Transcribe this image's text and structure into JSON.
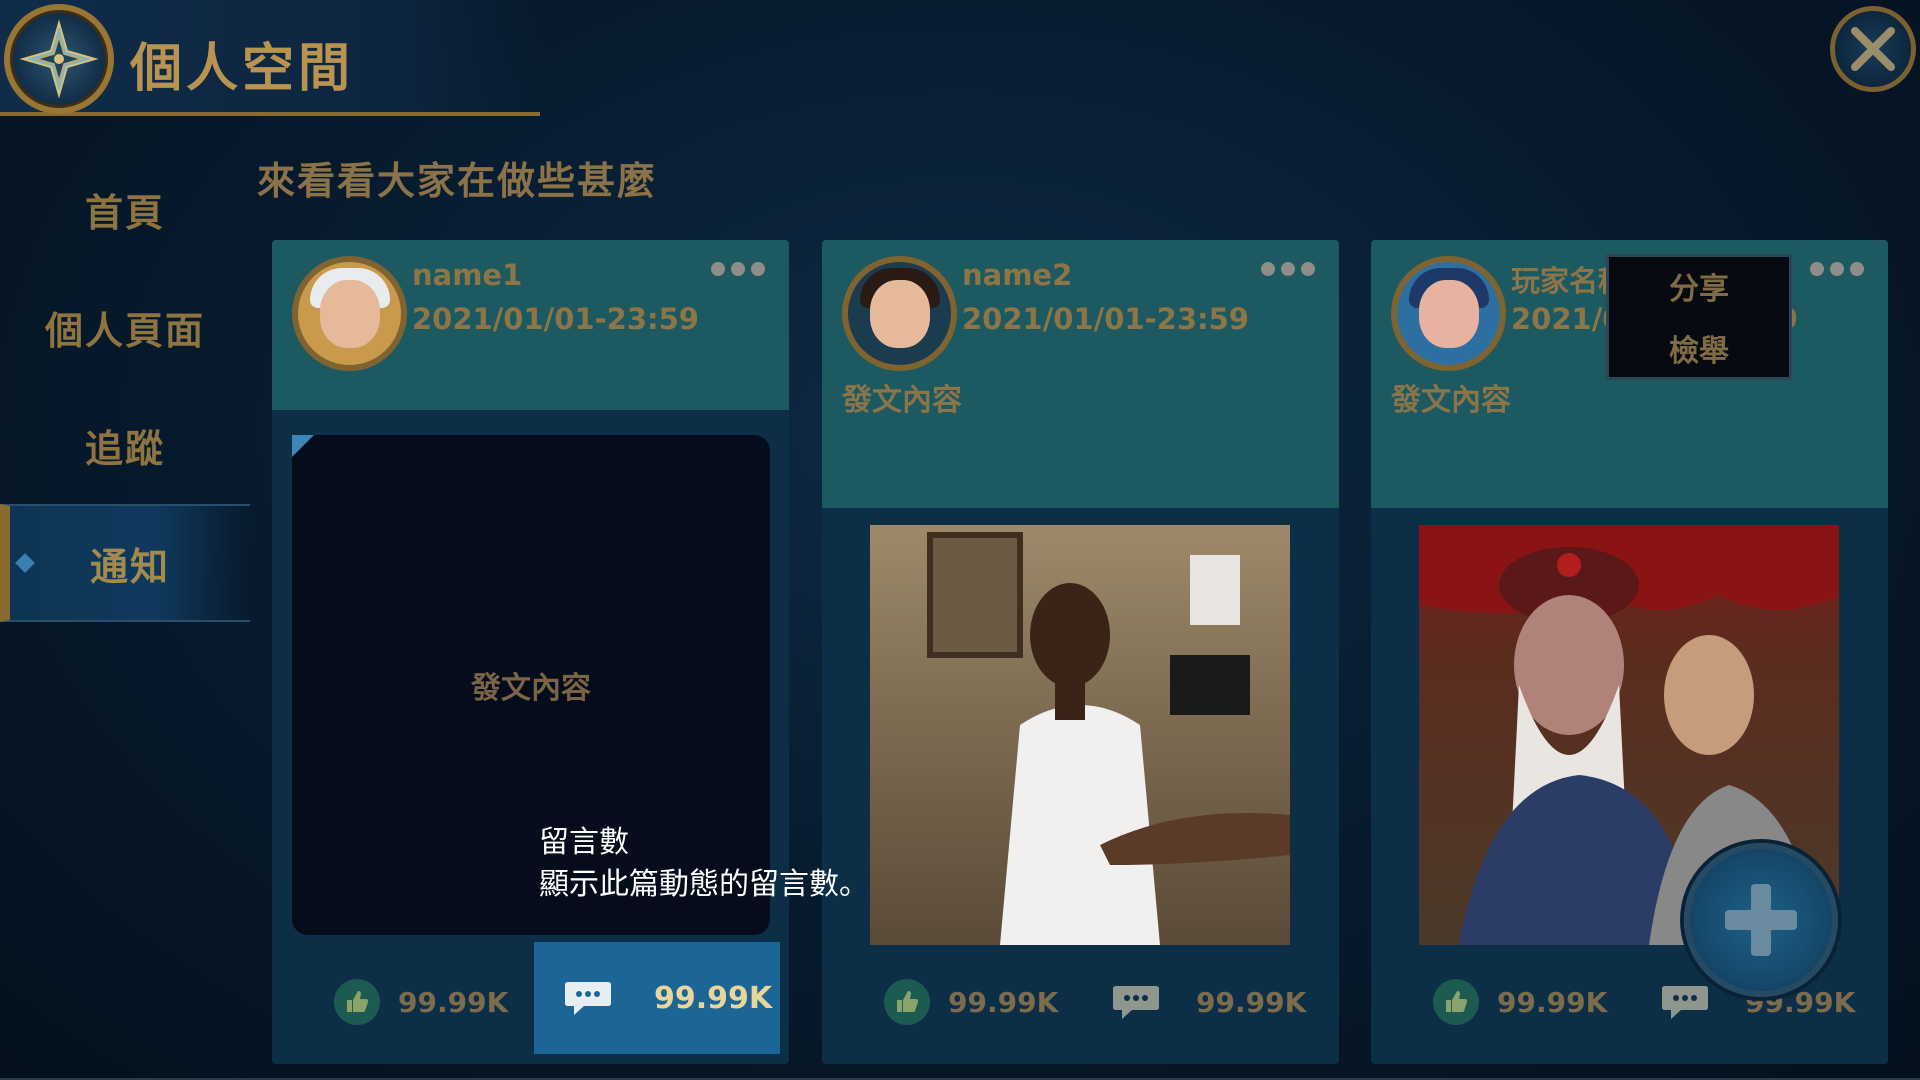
{
  "header": {
    "title": "個人空間"
  },
  "sidebar": {
    "items": [
      {
        "label": "首頁",
        "active": false
      },
      {
        "label": "個人頁面",
        "active": false
      },
      {
        "label": "追蹤",
        "active": false
      },
      {
        "label": "通知",
        "active": true
      }
    ]
  },
  "main": {
    "heading": "來看看大家在做些甚麼",
    "posts": [
      {
        "username": "name1",
        "timestamp": "2021/01/01-23:59",
        "content_label": "",
        "body_text": "發文內容",
        "likes": "99.99K",
        "comments": "99.99K"
      },
      {
        "username": "name2",
        "timestamp": "2021/01/01-23:59",
        "content_label": "發文內容",
        "likes": "99.99K",
        "comments": "99.99K"
      },
      {
        "username": "玩家名稱",
        "timestamp": "2021/01/01-23:59",
        "content_label": "發文內容",
        "likes": "99.99K",
        "comments": "99.99K"
      }
    ]
  },
  "dropdown": {
    "items": [
      "分享",
      "檢舉"
    ]
  },
  "tooltip": {
    "title": "留言數",
    "description": "顯示此篇動態的留言數。"
  },
  "icons": {
    "emblem": "compass-emblem-icon",
    "close": "close-icon",
    "like": "thumbs-up-icon",
    "comment": "comment-bubble-icon",
    "more": "more-dots-icon",
    "add": "plus-icon"
  },
  "colors": {
    "background": "#071a2d",
    "card_header": "#1d5960",
    "card_body": "#0c2e47",
    "gold_text": "#b99450",
    "highlight": "#1b6696"
  }
}
